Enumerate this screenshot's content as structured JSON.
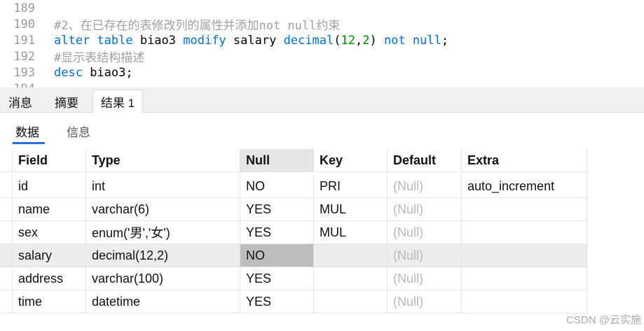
{
  "editor": {
    "lines": [
      {
        "num": "189",
        "text": ""
      },
      {
        "num": "190",
        "text": "#2、在已存在的表修改列的属性并添加not null约束"
      },
      {
        "num": "191",
        "text": "alter table biao3 modify salary decimal(12,2) not null;"
      },
      {
        "num": "192",
        "text": "#显示表结构描述"
      },
      {
        "num": "193",
        "text": "desc biao3;"
      },
      {
        "num": "194",
        "text": ""
      }
    ]
  },
  "tabs": [
    {
      "label": "消息"
    },
    {
      "label": "摘要"
    },
    {
      "label": "结果 1"
    }
  ],
  "subtabs": [
    {
      "label": "数据"
    },
    {
      "label": "信息"
    }
  ],
  "table": {
    "columns": [
      "Field",
      "Type",
      "Null",
      "Key",
      "Default",
      "Extra"
    ],
    "rows": [
      [
        "id",
        "int",
        "NO",
        "PRI",
        "(Null)",
        "auto_increment"
      ],
      [
        "name",
        "varchar(6)",
        "YES",
        "MUL",
        "(Null)",
        ""
      ],
      [
        "sex",
        "enum('男','女')",
        "YES",
        "MUL",
        "(Null)",
        ""
      ],
      [
        "salary",
        "decimal(12,2)",
        "NO",
        "",
        "(Null)",
        ""
      ],
      [
        "address",
        "varchar(100)",
        "YES",
        "",
        "(Null)",
        ""
      ],
      [
        "time",
        "datetime",
        "YES",
        "",
        "(Null)",
        ""
      ]
    ]
  },
  "watermark": "CSDN @云实施"
}
